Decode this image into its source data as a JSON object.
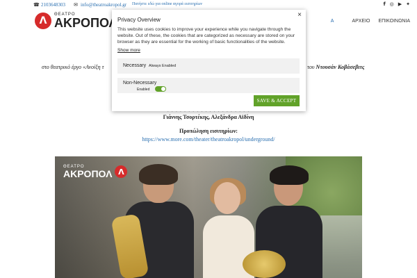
{
  "topbar": {
    "phone": "2103648303",
    "email": "info@theatroakropol.gr",
    "buy_tickets": "Πατήστε εδώ για online αγορά εισιτηρίων",
    "social_icons": [
      "facebook-icon",
      "instagram-icon",
      "youtube-icon",
      "twitter-icon"
    ]
  },
  "header": {
    "logo_small": "ΘΕΑΤΡΟ",
    "logo_big": "ΑΚΡΟΠΟΛ",
    "logo_letter": "Λ",
    "nav": [
      "Α",
      "ΑΡΧΕΙΟ",
      "ΕΠΙΚΟΙΝΩΝΙΑ"
    ]
  },
  "article": {
    "line_left": "στο θεατρικό έργο «Ανοίξη τ",
    "line_right_prefix": "του ",
    "line_right_bold": "Ντουσάν Κοβάσεβιτς",
    "credits_faint": "· · · · · · · · · · · · · · · · · · · ·",
    "credits": "Γιάννης Τσορτέκης, Αλεξάνδρα Αϊδίνη",
    "presale": "Προπώληση εισιτηρίων:",
    "link": "https://www.more.com/theater/theatroakropol/underground/"
  },
  "photo": {
    "logo_small": "ΘΕΑΤΡΟ",
    "logo_big": "ΑΚΡΟΠΟΛ",
    "logo_letter": "Λ"
  },
  "cookie": {
    "title": "Privacy Overview",
    "text": "This website uses cookies to improve your experience while you navigate through the website. Out of these, the cookies that are categorized as necessary are stored on your browser as they are essential for the working of basic functionalities of the website.",
    "show_more": "Show more",
    "necessary_label": "Necessary",
    "necessary_status": "Always Enabled",
    "non_necessary_label": "Non-Necessary",
    "non_necessary_status": "Enabled",
    "non_necessary_enabled": true,
    "save_label": "SAVE & ACCEPT",
    "close_symbol": "×",
    "accent_color": "#61a229"
  }
}
